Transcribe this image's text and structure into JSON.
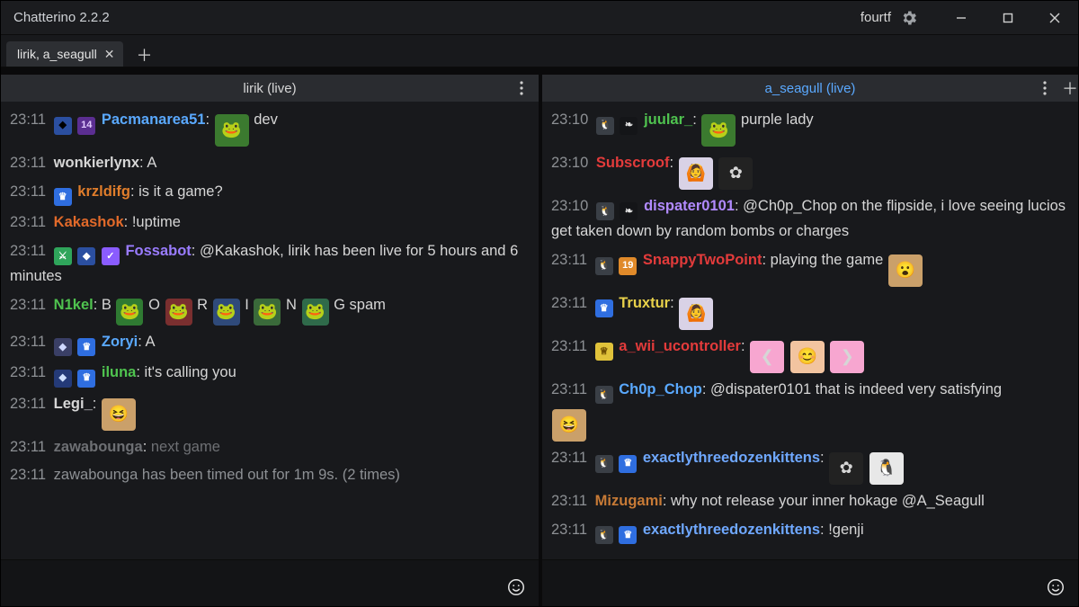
{
  "title": "Chatterino 2.2.2",
  "user": "fourtf",
  "tab": {
    "label": "lirik, a_seagull"
  },
  "left": {
    "header": "lirik (live)",
    "messages": [
      {
        "time": "23:11",
        "user": "Pacmanarea51",
        "color": "#5aa9ff",
        "text": "dev",
        "badges": [
          {
            "bg": "#2b4fa0",
            "fg": "#000",
            "char": "◆"
          },
          {
            "bg": "#5b2e91",
            "fg": "#e2c9ff",
            "char": "14"
          }
        ],
        "pre_emotes": [
          {
            "bg": "#3b7a2f",
            "char": "🐸"
          }
        ]
      },
      {
        "time": "23:11",
        "user": "wonkierlynx",
        "color": "#d6d6d6",
        "text": "A",
        "badges": []
      },
      {
        "time": "23:11",
        "user": "krzldifg",
        "color": "#e07d2b",
        "text": "is it a game?",
        "badges": [
          {
            "bg": "#2f6ee0",
            "fg": "#fff",
            "char": "♛"
          }
        ]
      },
      {
        "time": "23:11",
        "user": "Kakashok",
        "color": "#e26a2a",
        "text": "!uptime",
        "badges": []
      },
      {
        "time": "23:11",
        "user": "Fossabot",
        "color": "#9a7cff",
        "text": "@Kakashok, lirik has been live for 5 hours and 6 minutes",
        "badges": [
          {
            "bg": "#2fa55b",
            "fg": "#fff",
            "char": "⚔"
          },
          {
            "bg": "#2b4fa0",
            "fg": "#fff",
            "char": "◆"
          },
          {
            "bg": "#8a5cff",
            "fg": "#fff",
            "char": "✓"
          }
        ]
      },
      {
        "time": "23:11",
        "user": "N1kel",
        "color": "#4fc34f",
        "segments": [
          "B",
          "O",
          "R",
          "I",
          "N",
          "G spam"
        ],
        "seg_emotes": [
          {
            "bg": "#2f7a32",
            "char": "🐸"
          },
          {
            "bg": "#7a2f2f",
            "char": "🐸"
          },
          {
            "bg": "#2f4a7a",
            "char": "🐸"
          },
          {
            "bg": "#3a6a3a",
            "char": "🐸"
          },
          {
            "bg": "#2f6a4a",
            "char": "🐸"
          }
        ],
        "badges": []
      },
      {
        "time": "23:11",
        "user": "Zoryi",
        "color": "#5aa9ff",
        "text": "A",
        "badges": [
          {
            "bg": "#3a3f66",
            "fg": "#cfd8ff",
            "char": "◆"
          },
          {
            "bg": "#2f6ee0",
            "fg": "#fff",
            "char": "♛"
          }
        ]
      },
      {
        "time": "23:11",
        "user": "iluna",
        "color": "#4fc34f",
        "text": "it's calling you",
        "badges": [
          {
            "bg": "#243a78",
            "fg": "#cfe0ff",
            "char": "◆"
          },
          {
            "bg": "#2f6ee0",
            "fg": "#fff",
            "char": "♛"
          }
        ]
      },
      {
        "time": "23:11",
        "user": "Legi_",
        "color": "#d6d6d6",
        "text": "",
        "post_emotes": [
          {
            "bg": "#caa06a",
            "char": "😆"
          }
        ],
        "badges": []
      },
      {
        "time": "23:11",
        "user": "zawabounga",
        "color": "#b56a28",
        "text": "next game",
        "faded": true,
        "badges": []
      },
      {
        "time": "23:11",
        "system": "zawabounga has been timed out for 1m 9s. (2 times)"
      }
    ]
  },
  "right": {
    "header": "a_seagull (live)",
    "messages": [
      {
        "time": "23:10",
        "user": "juular_",
        "color": "#4fc34f",
        "text": "purple lady",
        "badges": [
          {
            "bg": "#3a3f46",
            "fg": "#fff",
            "char": "🐧"
          },
          {
            "bg": "#141518",
            "fg": "#e8e8e8",
            "char": "❧"
          }
        ],
        "post_name_emotes": [
          {
            "bg": "#3b7a2f",
            "char": "🐸"
          }
        ]
      },
      {
        "time": "23:10",
        "user": "Subscroof",
        "color": "#e33b3b",
        "text": "",
        "post_emotes": [
          {
            "bg": "#d9d2e6",
            "char": "🙆"
          },
          {
            "bg": "#222",
            "char": "✿"
          }
        ],
        "badges": []
      },
      {
        "time": "23:10",
        "user": "dispater0101",
        "color": "#b18aff",
        "text": "@Ch0p_Chop on the flipside, i love seeing lucios get taken down by random bombs or charges",
        "badges": [
          {
            "bg": "#3a3f46",
            "fg": "#fff",
            "char": "🐧"
          },
          {
            "bg": "#141518",
            "fg": "#e8e8e8",
            "char": "❧"
          }
        ]
      },
      {
        "time": "23:11",
        "user": "SnappyTwoPoint",
        "color": "#e33b3b",
        "text": "playing the game",
        "post_emotes": [
          {
            "bg": "#caa06a",
            "char": "😮"
          }
        ],
        "badges": [
          {
            "bg": "#3a3f46",
            "fg": "#fff",
            "char": "🐧"
          },
          {
            "bg": "#e08a2a",
            "fg": "#fff",
            "char": "19"
          }
        ]
      },
      {
        "time": "23:11",
        "user": "Truxtur",
        "color": "#e8d14a",
        "text": "",
        "post_emotes": [
          {
            "bg": "#d9d2e6",
            "char": "🙆"
          }
        ],
        "badges": [
          {
            "bg": "#2f6ee0",
            "fg": "#fff",
            "char": "♛"
          }
        ]
      },
      {
        "time": "23:11",
        "user": "a_wii_ucontroller",
        "color": "#e33b3b",
        "text": "",
        "post_emotes": [
          {
            "bg": "#f7a6d0",
            "char": "❮"
          },
          {
            "bg": "#f2c4a0",
            "char": "😊"
          },
          {
            "bg": "#f7a6d0",
            "char": "❯"
          }
        ],
        "badges": [
          {
            "bg": "#e0c23a",
            "fg": "#6a4a00",
            "char": "♕"
          }
        ]
      },
      {
        "time": "23:11",
        "user": "Ch0p_Chop",
        "color": "#5aa9ff",
        "text": "@dispater0101 that is indeed very satisfying",
        "post_emotes_newline": [
          {
            "bg": "#caa06a",
            "char": "😆"
          }
        ],
        "badges": [
          {
            "bg": "#3a3f46",
            "fg": "#fff",
            "char": "🐧"
          }
        ]
      },
      {
        "time": "23:11",
        "user": "exactlythreedozenkittens",
        "color": "#6fa8ff",
        "text": "",
        "post_emotes": [
          {
            "bg": "#222",
            "char": "✿"
          },
          {
            "bg": "#e8e8e8",
            "char": "🐧"
          }
        ],
        "badges": [
          {
            "bg": "#3a3f46",
            "fg": "#fff",
            "char": "🐧"
          },
          {
            "bg": "#2f6ee0",
            "fg": "#fff",
            "char": "♛"
          }
        ]
      },
      {
        "time": "23:11",
        "user": "Mizugami",
        "color": "#c77a36",
        "text": "why not release your inner hokage @A_Seagull",
        "badges": []
      },
      {
        "time": "23:11",
        "user": "exactlythreedozenkittens",
        "color": "#6fa8ff",
        "text": "!genji",
        "badges": [
          {
            "bg": "#3a3f46",
            "fg": "#fff",
            "char": "🐧"
          },
          {
            "bg": "#2f6ee0",
            "fg": "#fff",
            "char": "♛"
          }
        ]
      }
    ]
  }
}
